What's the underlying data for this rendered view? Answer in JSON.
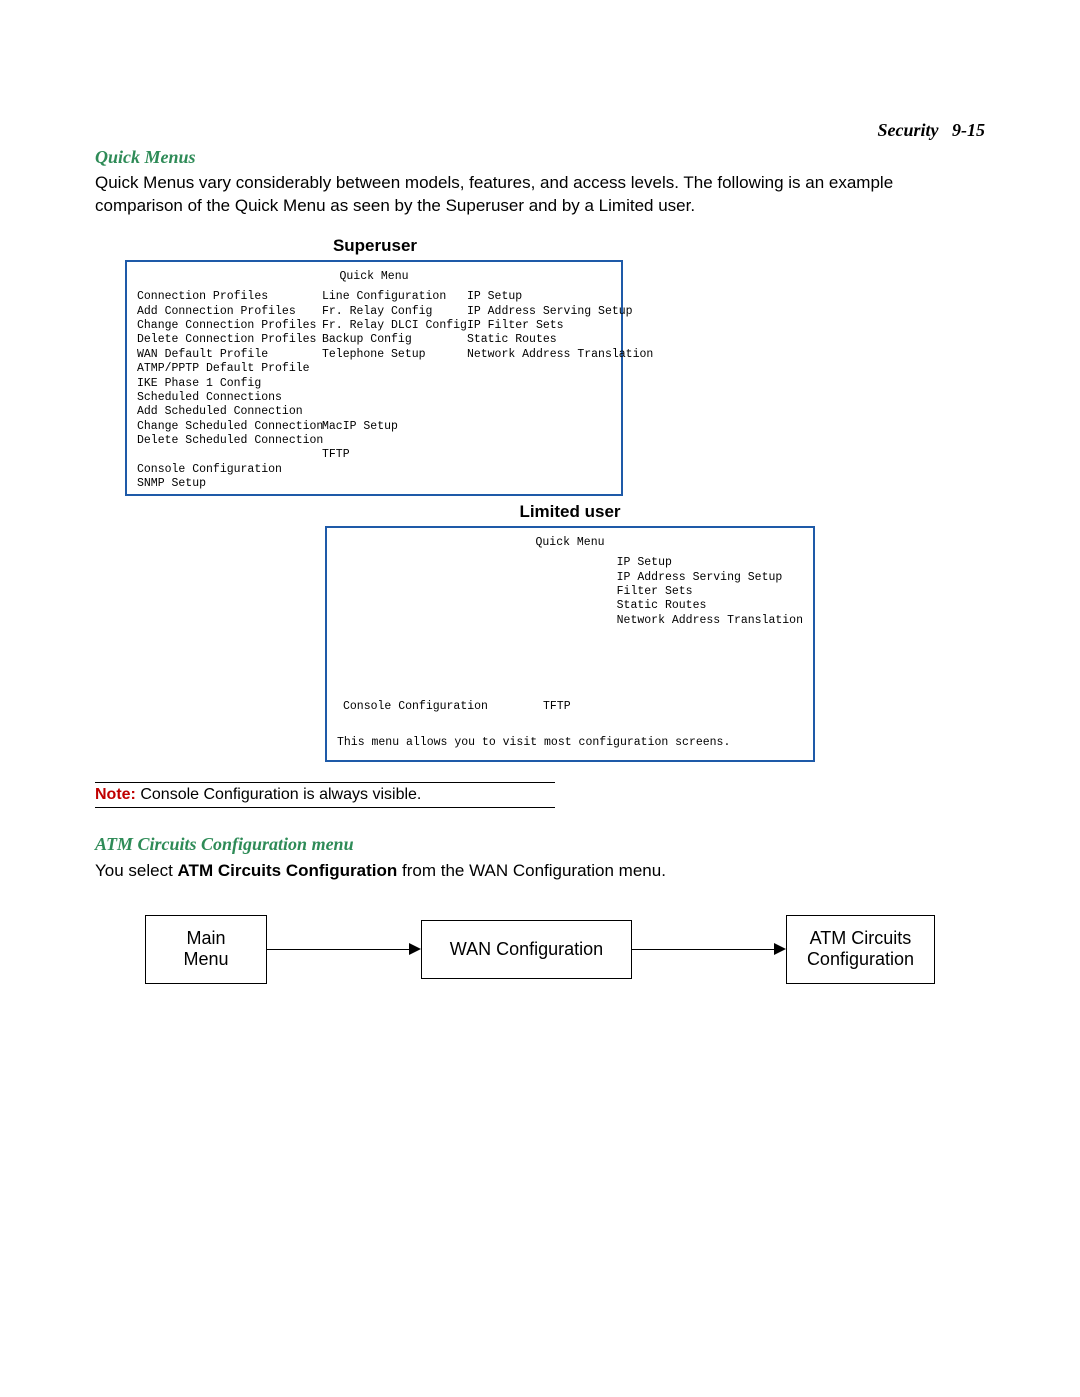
{
  "header": {
    "chapter": "Security",
    "pages": "9-15"
  },
  "quick_menus": {
    "heading": "Quick Menus",
    "paragraph": "Quick Menus vary considerably between models, features, and access levels. The following is an example comparison of the Quick Menu as seen by the Superuser and by a Limited user.",
    "superuser_label": "Superuser",
    "superuser_screen": {
      "title": "Quick Menu",
      "col1": [
        "Connection Profiles",
        "Add Connection Profiles",
        "Change Connection Profiles",
        "Delete Connection Profiles",
        "WAN Default Profile",
        "ATMP/PPTP Default Profile",
        "IKE Phase 1 Config",
        "Scheduled Connections",
        "Add Scheduled Connection",
        "Change Scheduled Connection",
        "Delete Scheduled Connection",
        "",
        "Console Configuration",
        "SNMP Setup"
      ],
      "col2": [
        "Line Configuration",
        "Fr. Relay Config",
        "Fr. Relay DLCI Config",
        "Backup Config",
        "Telephone Setup",
        "",
        "",
        "",
        "",
        "MacIP Setup",
        "",
        "TFTP"
      ],
      "col3": [
        "IP Setup",
        "IP Address Serving Setup",
        "IP Filter Sets",
        "Static Routes",
        "Network Address Translation"
      ]
    },
    "limited_label": "Limited user",
    "limited_screen": {
      "title": "Quick Menu",
      "right": [
        "IP Setup",
        "IP Address Serving Setup",
        "Filter Sets",
        "Static Routes",
        "Network Address Translation"
      ],
      "mid_left": "Console Configuration",
      "mid_right": "TFTP",
      "footer": "This menu allows you to visit most configuration screens."
    }
  },
  "note": {
    "label": "Note:",
    "text": " Console Configuration is always visible."
  },
  "atm": {
    "heading": "ATM Circuits Configuration menu",
    "sentence_pre": "You select ",
    "sentence_bold": "ATM Circuits Configuration",
    "sentence_post": " from the WAN Configuration menu."
  },
  "flow": {
    "box1_l1": "Main",
    "box1_l2": "Menu",
    "box2": "WAN Configuration",
    "box3_l1": "ATM Circuits",
    "box3_l2": "Configuration"
  }
}
